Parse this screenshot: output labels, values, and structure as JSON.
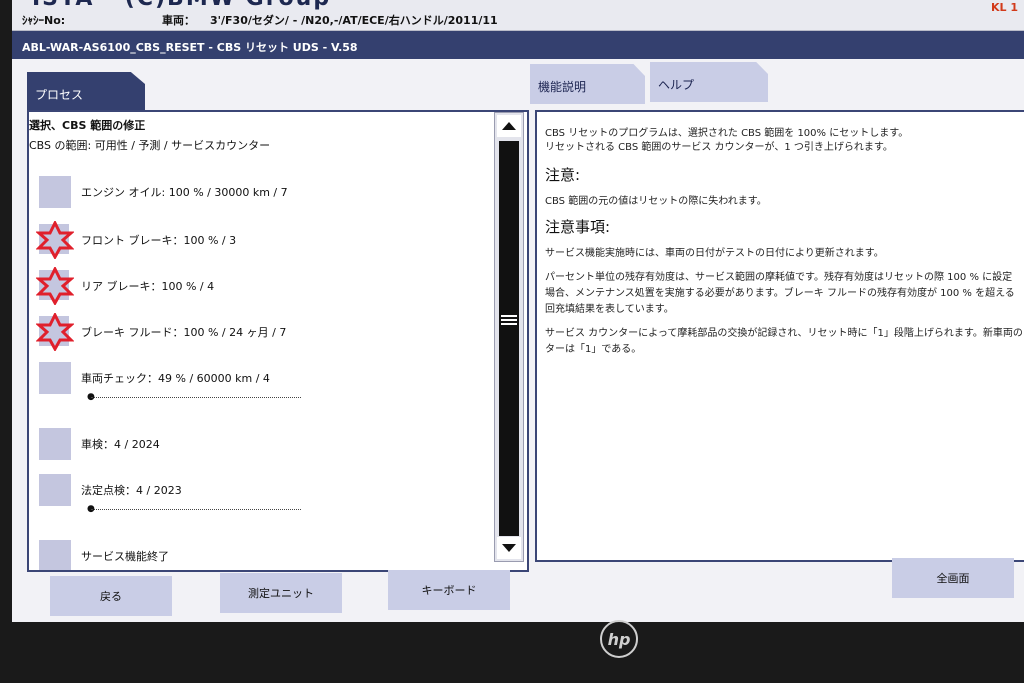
{
  "header": {
    "title_partial": "ISTA - (C)BMW Group",
    "chassis_label": "ｼｬｼｰNo:",
    "vehicle_label": "車両：",
    "vehicle_value": "3'/F30/セダン/ - /N20,-/AT/ECE/右ハンドル/2011/11",
    "corner": "KL 1"
  },
  "process_bar": {
    "title": "ABL-WAR-AS6100_CBS_RESET - CBS リセット UDS - V.58"
  },
  "tabs": {
    "process": "プロセス",
    "function_desc": "機能説明",
    "help": "ヘルプ"
  },
  "left": {
    "heading": "選択、CBS 範囲の修正",
    "subheading": "CBS の範囲: 可用性 / 予測 / サービスカウンター",
    "items": [
      {
        "label": "エンジン オイル: 100 % / 30000 km / 7"
      },
      {
        "label": "フロント ブレーキ：100 % / 3"
      },
      {
        "label": "リア ブレーキ：100 % / 4"
      },
      {
        "label": "ブレーキ フルード：100 % / 24 ヶ月 / 7"
      },
      {
        "label": "車両チェック：49 % / 60000 km / 4"
      },
      {
        "label": "車検：4 / 2024"
      },
      {
        "label": "法定点検：4 / 2023"
      },
      {
        "label": "サービス機能終了"
      }
    ]
  },
  "right": {
    "line1": "CBS リセットのプログラムは、選択された CBS 範囲を 100% にセットします。",
    "line2": "リセットされる CBS 範囲のサービス カウンターが、1 つ引き上げられます。",
    "caution_heading": "注意:",
    "caution_text": "CBS 範囲の元の値はリセットの際に失われます。",
    "notes_heading": "注意事項:",
    "note1": "サービス機能実施時には、車両の日付がテストの日付により更新されます。",
    "note2a": "パーセント単位の残存有効度は、サービス範囲の摩耗値です。残存有効度はリセットの際 100 % に設定",
    "note2b": "場合、メンテナンス処置を実施する必要があります。ブレーキ フルードの残存有効度が 100 % を超える",
    "note2c": "回充填結果を表しています。",
    "note3a": "サービス カウンターによって摩耗部品の交換が記録され、リセット時に「1」段階上げられます。新車両の",
    "note3b": "ターは「1」である。"
  },
  "buttons": {
    "back": "戻る",
    "measure_unit": "測定ユニット",
    "keyboard": "キーボード",
    "fullscreen": "全画面"
  },
  "brand": "hp",
  "colors": {
    "navy": "#34406f",
    "tab_bg": "#c9cde6",
    "star_red": "#e0202c"
  }
}
